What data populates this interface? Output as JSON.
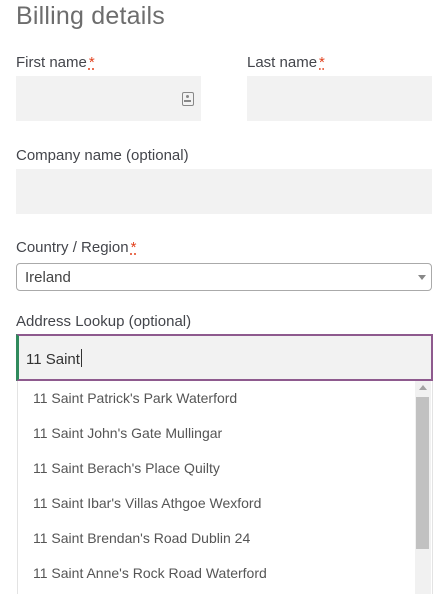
{
  "section": {
    "title": "Billing details"
  },
  "required_mark": "*",
  "first_name": {
    "label": "First name",
    "value": ""
  },
  "last_name": {
    "label": "Last name",
    "value": ""
  },
  "company": {
    "label": "Company name (optional)",
    "value": ""
  },
  "country": {
    "label": "Country / Region",
    "selected": "Ireland"
  },
  "address_lookup": {
    "label": "Address Lookup (optional)",
    "value": "11 Saint",
    "suggestions": [
      "11 Saint Patrick's Park Waterford",
      "11 Saint John's Gate Mullingar",
      "11 Saint Berach's Place Quilty",
      "11 Saint Ibar's Villas Athgoe Wexford",
      "11 Saint Brendan's Road Dublin 24",
      "11 Saint Anne's Rock Road Waterford"
    ]
  },
  "colors": {
    "input_bg": "#f2f2f2",
    "required": "#e2401c",
    "focus_border": "#8e5a8e",
    "focus_left": "#2f8a5c"
  }
}
